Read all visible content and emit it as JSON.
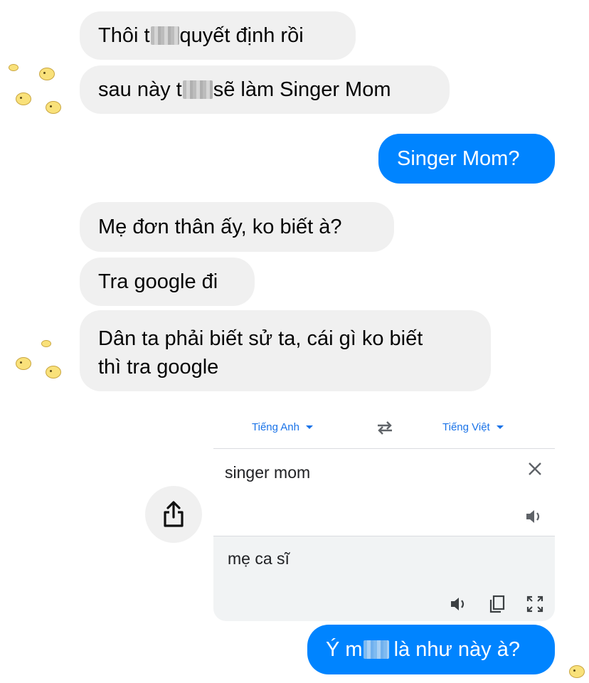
{
  "messages": {
    "m1": {
      "before": "Thôi t",
      "after": "quyết định rồi"
    },
    "m2": {
      "before": "sau này t",
      "after": "sẽ làm Singer Mom"
    },
    "m3": {
      "text": "Singer Mom?"
    },
    "m4": {
      "text": "Mẹ đơn thân ấy, ko biết à?"
    },
    "m5": {
      "text": "Tra google đi"
    },
    "m6": {
      "line1": "Dân ta phải biết sử ta, cái gì ko biết",
      "line2": "thì tra google"
    },
    "m7": {
      "before": "Ý m",
      "after": "là như này à?"
    }
  },
  "translate": {
    "source_lang": "Tiếng Anh",
    "target_lang": "Tiếng Việt",
    "source_text": "singer mom",
    "translated_text": "mẹ ca sĩ"
  },
  "colors": {
    "outgoing_bubble": "#0084ff",
    "incoming_bubble": "#f0f0f0",
    "translate_accent": "#1a73e8"
  },
  "icons": [
    "share-icon",
    "swap-languages-icon",
    "clear-icon",
    "speaker-icon",
    "copy-icon",
    "fullscreen-icon",
    "chick-sticker"
  ]
}
